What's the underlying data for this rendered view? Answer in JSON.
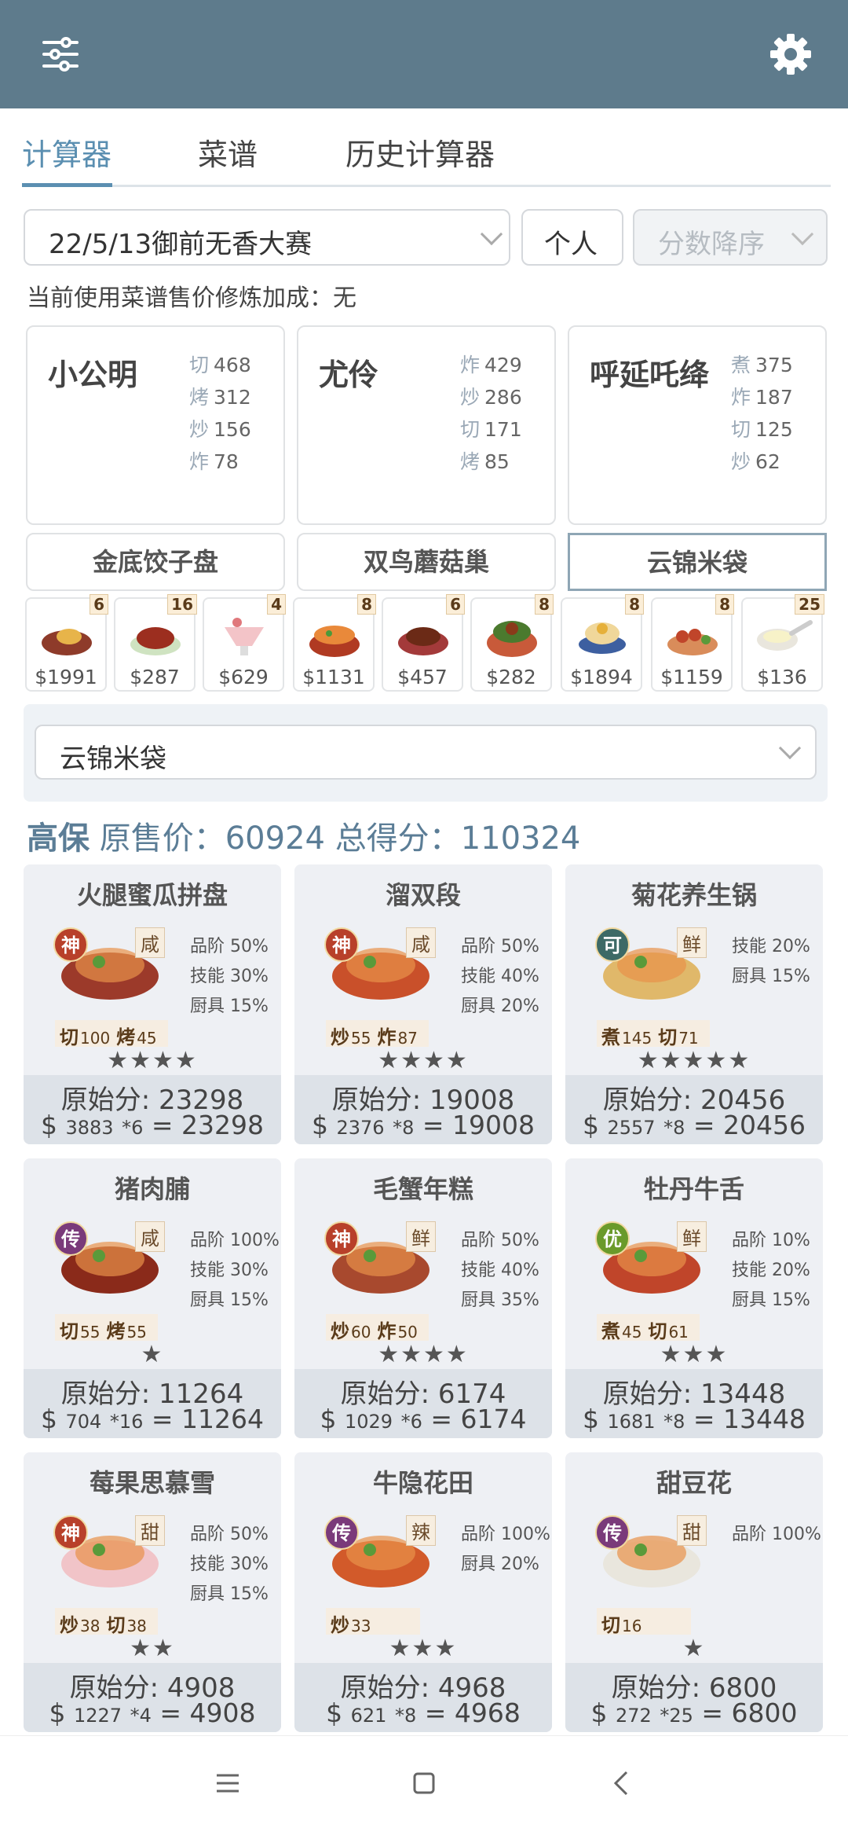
{
  "topbar": {
    "menu_icon": "sliders-icon",
    "settings_icon": "gear-icon"
  },
  "tabs": [
    "计算器",
    "菜谱",
    "历史计算器"
  ],
  "filters": {
    "contest": "22/5/13御前无香大赛",
    "mode": "个人",
    "sort": "分数降序"
  },
  "info": "当前使用菜谱售价修炼加成：无",
  "chefs": [
    {
      "name": "小公明",
      "skills": [
        {
          "k": "切",
          "v": "468"
        },
        {
          "k": "烤",
          "v": "312"
        },
        {
          "k": "炒",
          "v": "156"
        },
        {
          "k": "炸",
          "v": "78"
        }
      ]
    },
    {
      "name": "尤伶",
      "skills": [
        {
          "k": "炸",
          "v": "429"
        },
        {
          "k": "炒",
          "v": "286"
        },
        {
          "k": "切",
          "v": "171"
        },
        {
          "k": "烤",
          "v": "85"
        }
      ]
    },
    {
      "name": "呼延吒绛",
      "skills": [
        {
          "k": "煮",
          "v": "375"
        },
        {
          "k": "炸",
          "v": "187"
        },
        {
          "k": "切",
          "v": "125"
        },
        {
          "k": "炒",
          "v": "62"
        }
      ]
    }
  ],
  "equips": [
    "金底饺子盘",
    "双鸟蘑菇巢",
    "云锦米袋"
  ],
  "dishes": [
    {
      "count": "6",
      "price": "$1991"
    },
    {
      "count": "16",
      "price": "$287"
    },
    {
      "count": "4",
      "price": "$629"
    },
    {
      "count": "8",
      "price": "$1131"
    },
    {
      "count": "6",
      "price": "$457"
    },
    {
      "count": "8",
      "price": "$282"
    },
    {
      "count": "8",
      "price": "$1894"
    },
    {
      "count": "8",
      "price": "$1159"
    },
    {
      "count": "25",
      "price": "$136"
    }
  ],
  "equip_select": "云锦米袋",
  "summary": {
    "name": "高保",
    "orig_label": "原售价：",
    "orig": "60924",
    "total_label": "总得分：",
    "total": "110324"
  },
  "score_label": "原始分: ",
  "cards": [
    {
      "title": "火腿蜜瓜拼盘",
      "rarity": "神",
      "flavor": "咸",
      "stats": [
        "品阶 50%",
        "技能 30%",
        "厨具 15%"
      ],
      "skills": [
        {
          "k": "切",
          "v": "100"
        },
        {
          "k": "烤",
          "v": "45"
        }
      ],
      "stars": "★★★★",
      "score": "23298",
      "price": "3883",
      "mult": "*6",
      "total": "23298"
    },
    {
      "title": "溜双段",
      "rarity": "神",
      "flavor": "咸",
      "stats": [
        "品阶 50%",
        "技能 40%",
        "厨具 20%"
      ],
      "skills": [
        {
          "k": "炒",
          "v": "55"
        },
        {
          "k": "炸",
          "v": "87"
        }
      ],
      "stars": "★★★★",
      "score": "19008",
      "price": "2376",
      "mult": "*8",
      "total": "19008"
    },
    {
      "title": "菊花养生锅",
      "rarity": "可",
      "flavor": "鲜",
      "stats": [
        "技能 20%",
        "厨具 15%"
      ],
      "skills": [
        {
          "k": "煮",
          "v": "145"
        },
        {
          "k": "切",
          "v": "71"
        }
      ],
      "stars": "★★★★★",
      "score": "20456",
      "price": "2557",
      "mult": "*8",
      "total": "20456"
    },
    {
      "title": "猪肉脯",
      "rarity": "传",
      "flavor": "咸",
      "stats": [
        "品阶 100%",
        "技能 30%",
        "厨具 15%"
      ],
      "skills": [
        {
          "k": "切",
          "v": "55"
        },
        {
          "k": "烤",
          "v": "55"
        }
      ],
      "stars": "★",
      "score": "11264",
      "price": "704",
      "mult": "*16",
      "total": "11264"
    },
    {
      "title": "毛蟹年糕",
      "rarity": "神",
      "flavor": "鲜",
      "stats": [
        "品阶 50%",
        "技能 40%",
        "厨具 35%"
      ],
      "skills": [
        {
          "k": "炒",
          "v": "60"
        },
        {
          "k": "炸",
          "v": "50"
        }
      ],
      "stars": "★★★★",
      "score": "6174",
      "price": "1029",
      "mult": "*6",
      "total": "6174"
    },
    {
      "title": "牡丹牛舌",
      "rarity": "优",
      "flavor": "鲜",
      "stats": [
        "品阶 10%",
        "技能 20%",
        "厨具 15%"
      ],
      "skills": [
        {
          "k": "煮",
          "v": "45"
        },
        {
          "k": "切",
          "v": "61"
        }
      ],
      "stars": "★★★",
      "score": "13448",
      "price": "1681",
      "mult": "*8",
      "total": "13448"
    },
    {
      "title": "莓果思慕雪",
      "rarity": "神",
      "flavor": "甜",
      "stats": [
        "品阶 50%",
        "技能 30%",
        "厨具 15%"
      ],
      "skills": [
        {
          "k": "炒",
          "v": "38"
        },
        {
          "k": "切",
          "v": "38"
        }
      ],
      "stars": "★★",
      "score": "4908",
      "price": "1227",
      "mult": "*4",
      "total": "4908"
    },
    {
      "title": "牛隐花田",
      "rarity": "传",
      "flavor": "辣",
      "stats": [
        "品阶 100%",
        "厨具 20%"
      ],
      "skills": [
        {
          "k": "炒",
          "v": "33"
        }
      ],
      "stars": "★★★",
      "score": "4968",
      "price": "621",
      "mult": "*8",
      "total": "4968"
    },
    {
      "title": "甜豆花",
      "rarity": "传",
      "flavor": "甜",
      "stats": [
        "品阶 100%"
      ],
      "skills": [
        {
          "k": "切",
          "v": "16"
        }
      ],
      "stars": "★",
      "score": "6800",
      "price": "272",
      "mult": "*25",
      "total": "6800"
    }
  ],
  "navbar": {
    "menu": "menu-icon",
    "home": "home-icon",
    "back": "back-icon"
  }
}
